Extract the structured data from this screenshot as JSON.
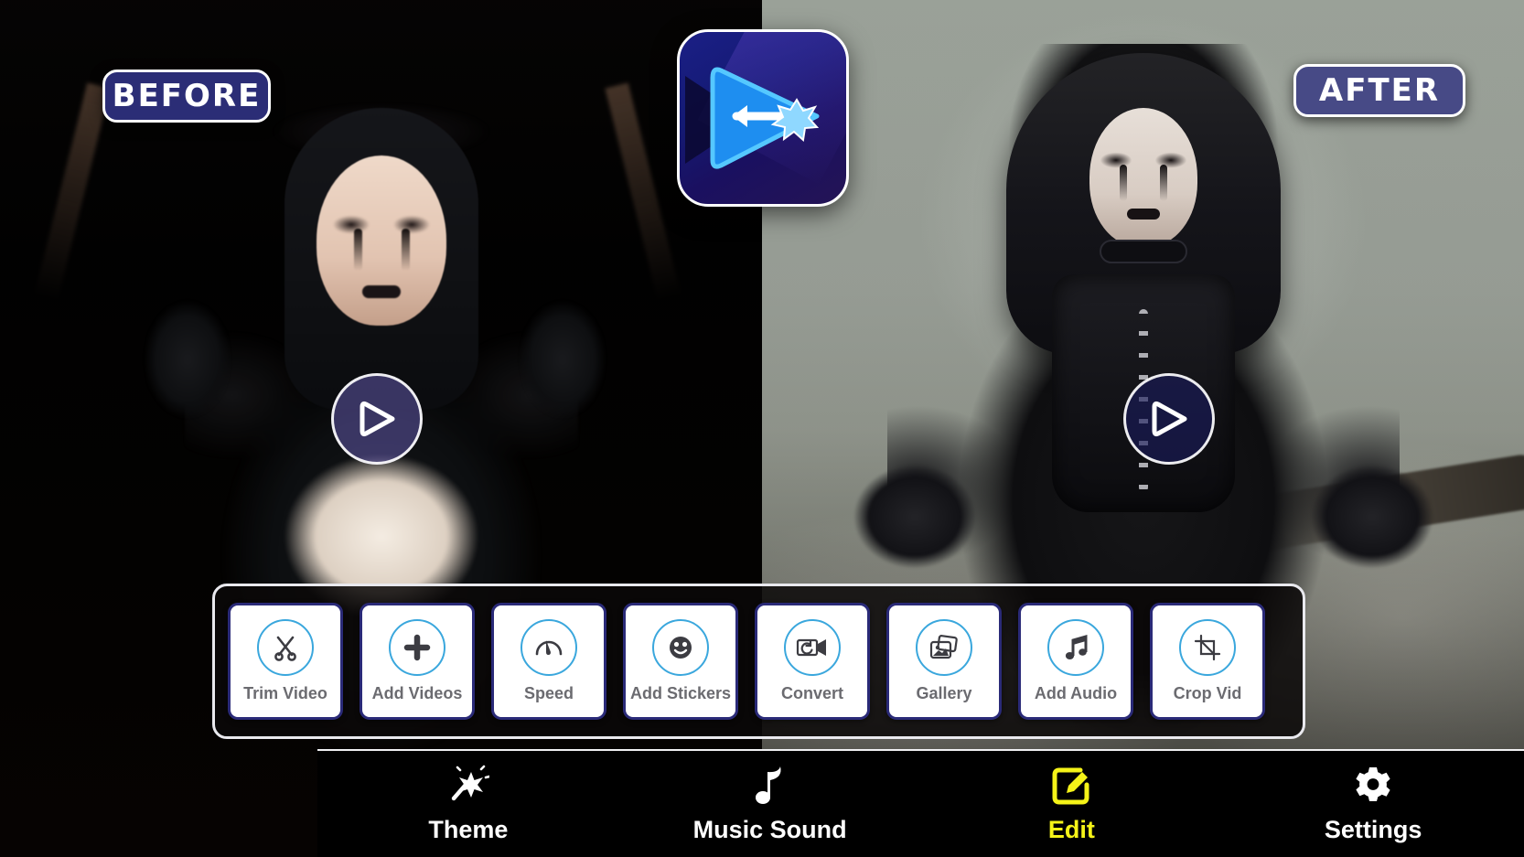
{
  "app": {
    "logo_icon": "video-editor-play-wand-logo"
  },
  "comparison": {
    "before_label": "BEFORE",
    "after_label": "AFTER",
    "before_play_icon": "play-icon",
    "after_play_icon": "play-icon"
  },
  "toolbar": {
    "items": [
      {
        "label": "Trim Video",
        "icon": "scissors-icon"
      },
      {
        "label": "Add Videos",
        "icon": "plus-icon"
      },
      {
        "label": "Speed",
        "icon": "speedometer-icon"
      },
      {
        "label": "Add Stickers",
        "icon": "smiley-icon"
      },
      {
        "label": "Convert",
        "icon": "video-convert-icon"
      },
      {
        "label": "Gallery",
        "icon": "photo-stack-icon"
      },
      {
        "label": "Add Audio",
        "icon": "music-note-icon"
      },
      {
        "label": "Crop Vid",
        "icon": "crop-icon"
      }
    ]
  },
  "bottom_nav": {
    "items": [
      {
        "label": "Theme",
        "icon": "magic-wand-icon",
        "active": false
      },
      {
        "label": "Music Sound",
        "icon": "music-note-icon",
        "active": false
      },
      {
        "label": "Edit",
        "icon": "pencil-square-icon",
        "active": true
      },
      {
        "label": "Settings",
        "icon": "gear-icon",
        "active": false
      }
    ]
  },
  "colors": {
    "badge_before_bg": "#2b2d76",
    "badge_after_bg": "#474a86",
    "card_border": "#2a2a78",
    "icon_circle": "#3aa7dd",
    "active_nav": "#f5f318",
    "panel_border": "#e9e9ee"
  }
}
